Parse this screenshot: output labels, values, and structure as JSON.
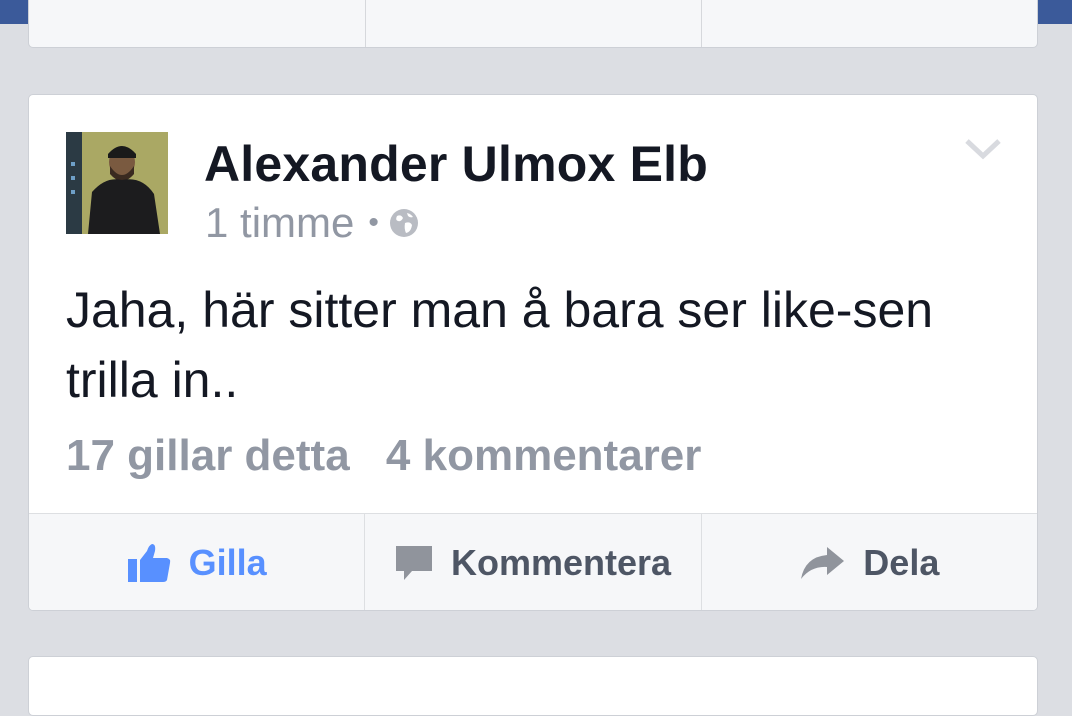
{
  "post": {
    "author": "Alexander Ulmox Elb",
    "time": "1 timme",
    "separator": "•",
    "privacy_icon": "globe-icon",
    "text": "Jaha, här sitter man å bara ser like-sen trilla in..",
    "likes": "17 gillar detta",
    "comments": "4 kommentarer"
  },
  "actions": {
    "like": "Gilla",
    "comment": "Kommentera",
    "share": "Dela"
  },
  "colors": {
    "topbar": "#3b5a9a",
    "background": "#dcdee3",
    "like_blue": "#5890ff",
    "meta_gray": "#9197a3",
    "text": "#141823"
  }
}
